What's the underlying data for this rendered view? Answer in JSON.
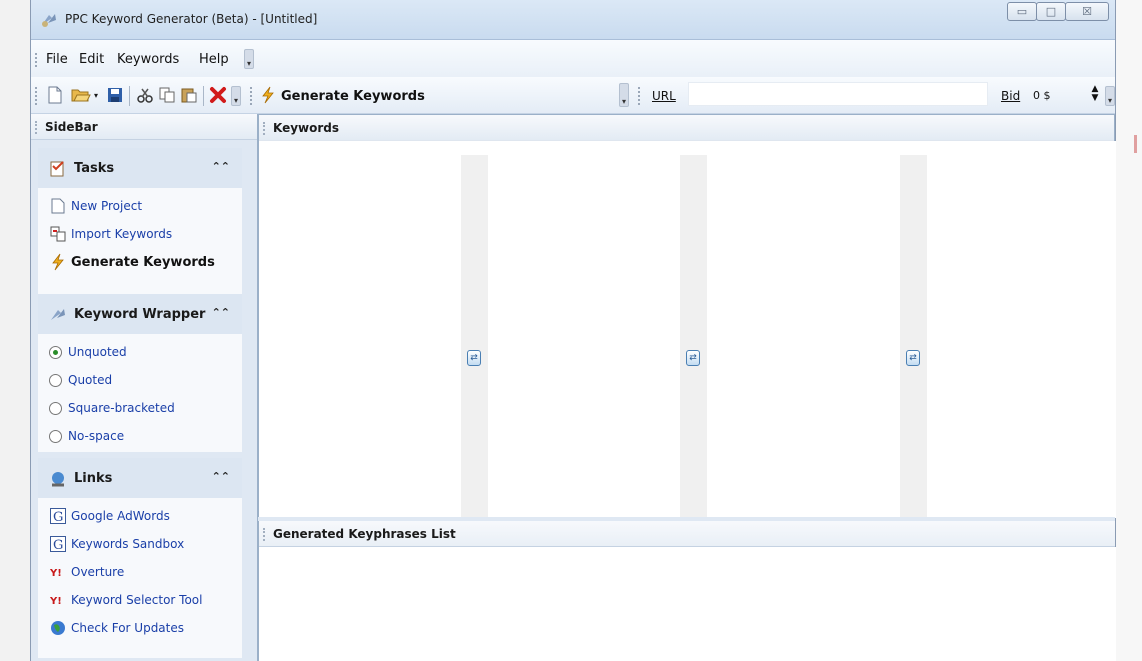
{
  "window": {
    "title": "PPC Keyword Generator (Beta) - [Untitled]",
    "controls": {
      "minimize": "▭",
      "maximize": "□",
      "close": "☒"
    }
  },
  "menu": {
    "file": "File",
    "edit": "Edit",
    "keywords": "Keywords",
    "help": "Help"
  },
  "toolbar": {
    "generate_label": "Generate Keywords",
    "url_label": "URL",
    "url_value": "",
    "bid_label": "Bid",
    "bid_value": "0 $",
    "icons": [
      "new-file-icon",
      "open-folder-icon",
      "save-icon",
      "cut-icon",
      "copy-icon",
      "paste-icon",
      "delete-icon",
      "lightning-icon"
    ]
  },
  "sidebar": {
    "title": "SideBar",
    "tasks": {
      "title": "Tasks",
      "items": [
        {
          "label": "New Project",
          "icon": "new-file-icon"
        },
        {
          "label": "Import Keywords",
          "icon": "import-icon"
        },
        {
          "label": "Generate Keywords",
          "icon": "lightning-icon"
        }
      ]
    },
    "wrapper": {
      "title": "Keyword Wrapper",
      "options": [
        {
          "label": "Unquoted",
          "selected": true
        },
        {
          "label": "Quoted",
          "selected": false
        },
        {
          "label": "Square-bracketed",
          "selected": false
        },
        {
          "label": "No-space",
          "selected": false
        }
      ]
    },
    "links": {
      "title": "Links",
      "items": [
        {
          "label": "Google AdWords",
          "icon": "google-icon"
        },
        {
          "label": "Keywords Sandbox",
          "icon": "google-icon"
        },
        {
          "label": "Overture",
          "icon": "yahoo-icon"
        },
        {
          "label": "Keyword Selector Tool",
          "icon": "yahoo-icon"
        },
        {
          "label": "Check For Updates",
          "icon": "globe-icon"
        }
      ]
    }
  },
  "keywords": {
    "title": "Keywords"
  },
  "keyphrases": {
    "title": "Generated Keyphrases List"
  },
  "colors": {
    "link": "#1a3fa8",
    "panel_bg": "#dfe8f3",
    "frame": "#9bb0c8"
  }
}
